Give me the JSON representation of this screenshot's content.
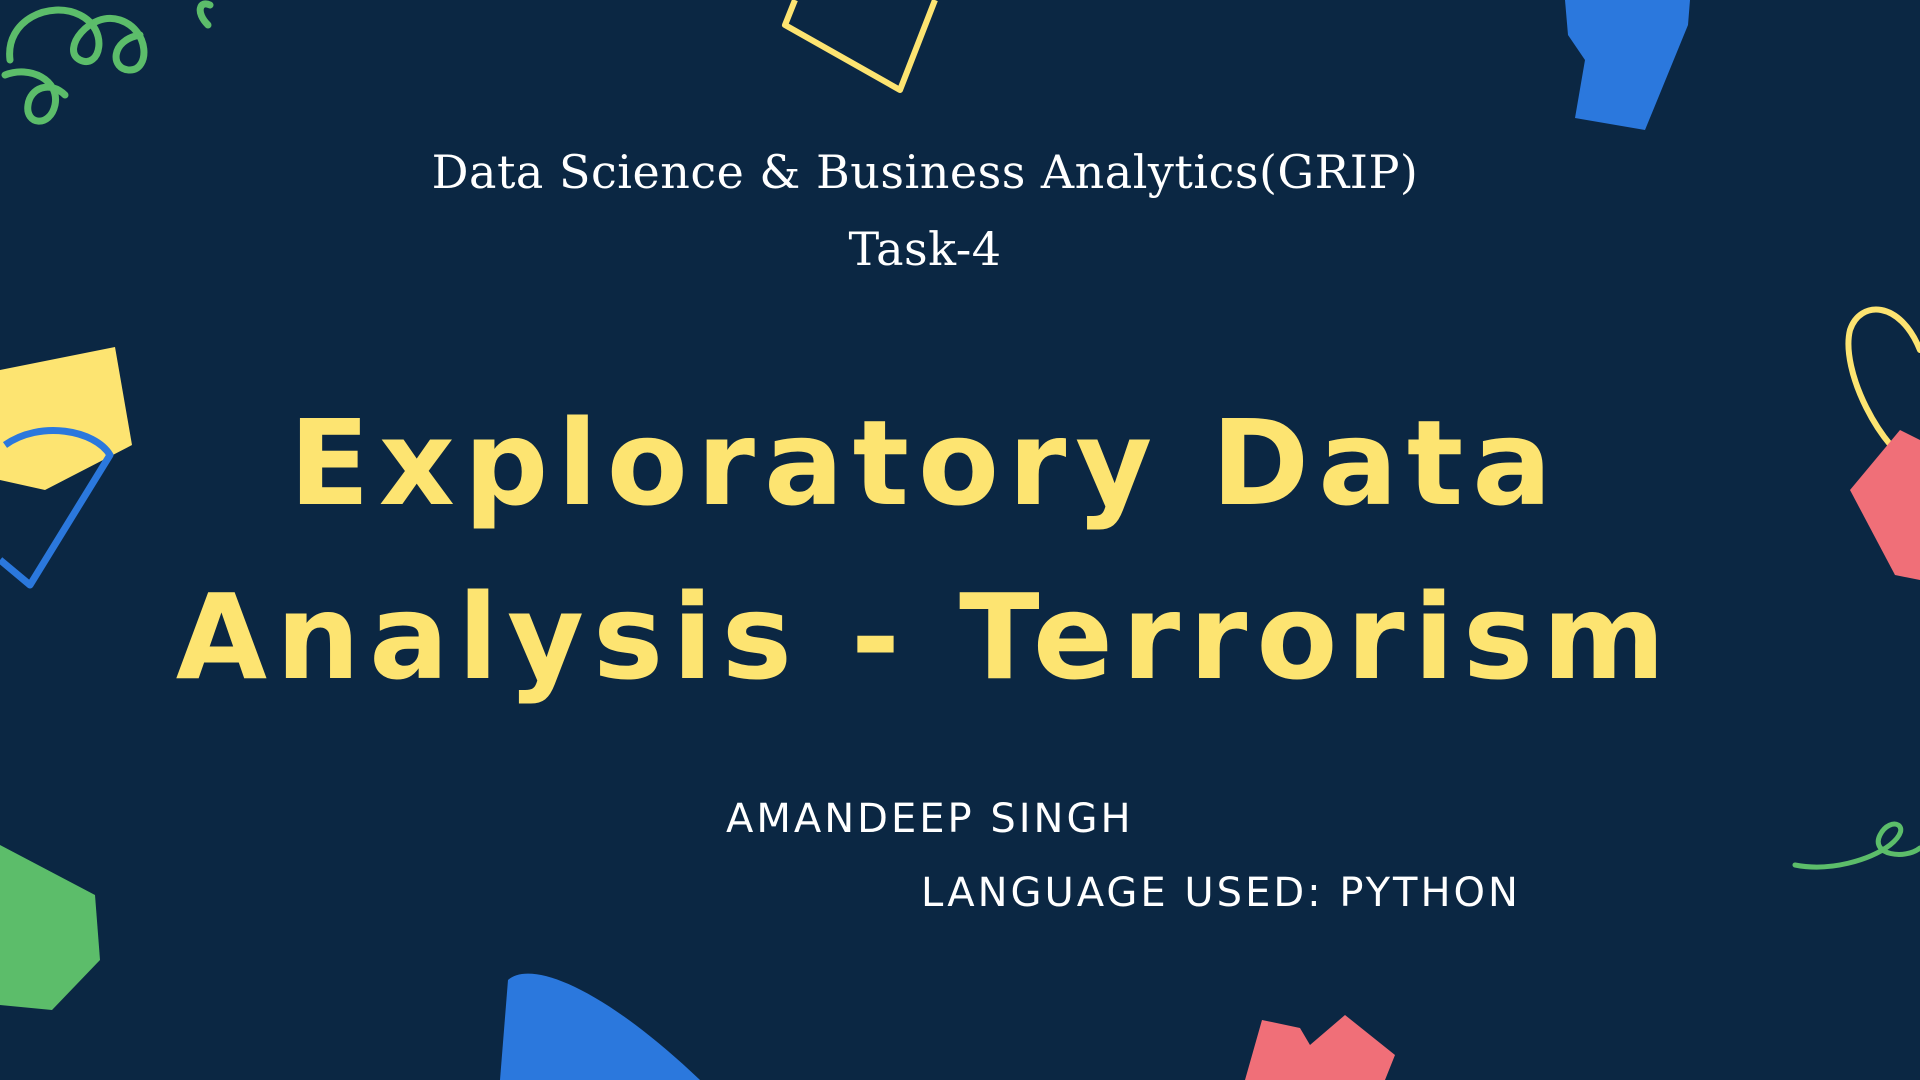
{
  "slide": {
    "subtitle_line_1": "Data Science & Business Analytics(GRIP)",
    "subtitle_line_2": "Task-4",
    "title_line_1": "Exploratory Data",
    "title_line_2": "Analysis - Terrorism",
    "author": "AMANDEEP SINGH",
    "language": "LANGUAGE USED: PYTHON"
  },
  "colors": {
    "background": "#0b2743",
    "title": "#fde471",
    "text": "#ffffff",
    "green": "#5cbd6a",
    "yellow": "#fde471",
    "blue": "#2b78dd",
    "pink": "#f06f78"
  },
  "decorations": [
    "green-squiggle-top-left",
    "yellow-outline-square-top",
    "blue-block-top-right",
    "yellow-square-left",
    "blue-outline-shape-left",
    "yellow-loop-right",
    "pink-square-right",
    "green-squiggle-right",
    "green-block-bottom-left",
    "blue-half-circle-bottom",
    "pink-block-bottom"
  ]
}
